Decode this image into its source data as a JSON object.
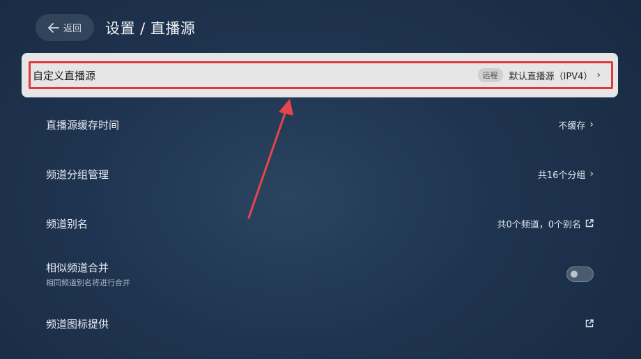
{
  "header": {
    "back_label": "返回",
    "title": "设置 / 直播源"
  },
  "items": [
    {
      "label": "自定义直播源",
      "tag": "远程",
      "value": "默认直播源（IPV4）",
      "icon": "chevron-right-icon"
    },
    {
      "label": "直播源缓存时间",
      "value": "不缓存",
      "icon": "chevron-right-icon"
    },
    {
      "label": "频道分组管理",
      "value": "共16个分组",
      "icon": "chevron-right-icon"
    },
    {
      "label": "频道别名",
      "value": "共0个频道，0个别名",
      "icon": "external-link-icon"
    },
    {
      "label": "相似频道合并",
      "sublabel": "相同频道别名将进行合并",
      "toggle_on": false
    },
    {
      "label": "频道图标提供",
      "value": "",
      "icon": "external-link-icon"
    }
  ],
  "colors": {
    "highlight_outline": "#e2373b",
    "annotation_arrow": "#e8454a",
    "selected_row_bg": "#e6e6e6"
  }
}
